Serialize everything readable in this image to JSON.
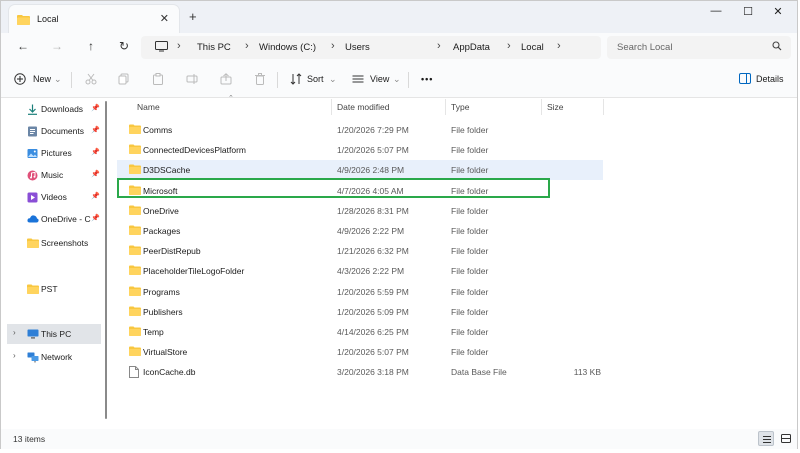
{
  "tab": {
    "title": "Local",
    "close_glyph": "✕",
    "new_tab_glyph": "+"
  },
  "window_controls": {
    "minimize": "—",
    "maximize": "☐",
    "close": "✕"
  },
  "nav": {
    "back": "←",
    "forward": "→",
    "up": "↑",
    "refresh": "↻"
  },
  "breadcrumbs": [
    "This PC",
    "Windows (C:)",
    "Users",
    "AppData",
    "Local"
  ],
  "search": {
    "placeholder": "Search Local"
  },
  "commands": {
    "new": "New",
    "sort": "Sort",
    "view": "View",
    "more": "•••",
    "details": "Details"
  },
  "sidebar": {
    "quick_access": [
      {
        "label": "Downloads",
        "icon": "download-icon",
        "pinned": true
      },
      {
        "label": "Documents",
        "icon": "document-icon",
        "pinned": true
      },
      {
        "label": "Pictures",
        "icon": "pictures-icon",
        "pinned": true
      },
      {
        "label": "Music",
        "icon": "music-icon",
        "pinned": true
      },
      {
        "label": "Videos",
        "icon": "video-icon",
        "pinned": true
      },
      {
        "label": "OneDrive - C",
        "icon": "onedrive-icon",
        "pinned": true
      },
      {
        "label": "Screenshots",
        "icon": "folder-icon",
        "pinned": false
      }
    ],
    "pst": {
      "label": "PST"
    },
    "this_pc": {
      "label": "This PC"
    },
    "network": {
      "label": "Network"
    }
  },
  "columns": {
    "name": "Name",
    "date": "Date modified",
    "type": "Type",
    "size": "Size"
  },
  "rows": [
    {
      "name": "Comms",
      "date": "1/20/2026 7:29 PM",
      "type": "File folder",
      "size": ""
    },
    {
      "name": "ConnectedDevicesPlatform",
      "date": "1/20/2026 5:07 PM",
      "type": "File folder",
      "size": ""
    },
    {
      "name": "D3DSCache",
      "date": "4/9/2026 2:48 PM",
      "type": "File folder",
      "size": ""
    },
    {
      "name": "Microsoft",
      "date": "4/7/2026 4:05 AM",
      "type": "File folder",
      "size": ""
    },
    {
      "name": "OneDrive",
      "date": "1/28/2026 8:31 PM",
      "type": "File folder",
      "size": ""
    },
    {
      "name": "Packages",
      "date": "4/9/2026 2:22 PM",
      "type": "File folder",
      "size": ""
    },
    {
      "name": "PeerDistRepub",
      "date": "1/21/2026 6:32 PM",
      "type": "File folder",
      "size": ""
    },
    {
      "name": "PlaceholderTileLogoFolder",
      "date": "4/3/2026 2:22 PM",
      "type": "File folder",
      "size": ""
    },
    {
      "name": "Programs",
      "date": "1/20/2026 5:59 PM",
      "type": "File folder",
      "size": ""
    },
    {
      "name": "Publishers",
      "date": "1/20/2026 5:09 PM",
      "type": "File folder",
      "size": ""
    },
    {
      "name": "Temp",
      "date": "4/14/2026 6:25 PM",
      "type": "File folder",
      "size": ""
    },
    {
      "name": "VirtualStore",
      "date": "1/20/2026 5:07 PM",
      "type": "File folder",
      "size": ""
    },
    {
      "name": "IconCache.db",
      "date": "3/20/2026 3:18 PM",
      "type": "Data Base File",
      "size": "113 KB"
    }
  ],
  "status": {
    "count": "13 items"
  },
  "colors": {
    "folder": "#f8c740",
    "highlight": "#2aa84a",
    "hover_row": "#e8f0fb",
    "accent": "#0067c0"
  }
}
